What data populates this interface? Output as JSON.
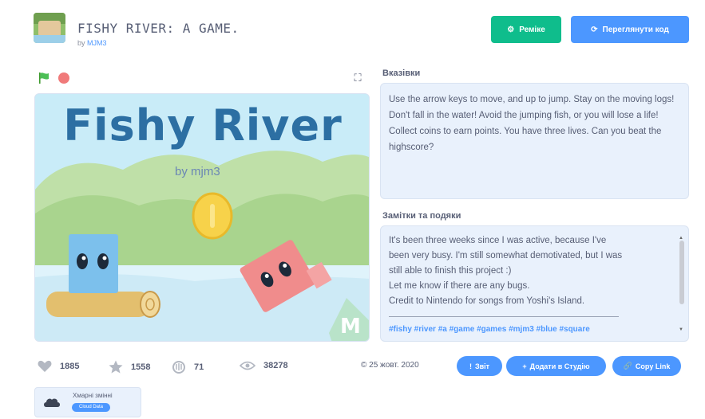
{
  "header": {
    "title": "FISHY RIVER: A GAME.",
    "by_prefix": "by",
    "author": "MJM3",
    "remix_label": "Реміке",
    "see_inside_label": "Переглянути код"
  },
  "stage": {
    "game_title": "Fishy River",
    "game_byline": "by mjm3"
  },
  "instructions": {
    "heading": "Вказівки",
    "text": "Use the arrow keys to move, and up to jump. Stay on the moving logs! Don't fall in the water! Avoid the jumping fish, or you will lose a life! Collect coins to earn points. You have three lives. Can you beat the highscore?"
  },
  "notes": {
    "heading": "Замітки та подяки",
    "lines": [
      "It's been three weeks since I was active, because I've",
      "been very busy. I'm still somewhat demotivated, but I was",
      "still able to finish this project :)",
      "Let me know if there are any bugs.",
      "Credit to Nintendo for songs from Yoshi's Island."
    ],
    "tags": "#fishy #river #a #game #games #mjm3 #blue #square"
  },
  "stats": {
    "loves": "1885",
    "favorites": "1558",
    "remixes": "71",
    "views": "38278"
  },
  "date": "© 25 жовт. 2020",
  "actions": {
    "share_label": "Звіт",
    "add_to_studio_label": "Додати в Студію",
    "copy_link_label": "Copy Link"
  },
  "studio": {
    "name": "Хмарні змінні",
    "chip": "Cloud Data"
  },
  "colors": {
    "remix": "#0fbd8c",
    "primary": "#4c97ff",
    "panel": "#e9f1fc"
  }
}
